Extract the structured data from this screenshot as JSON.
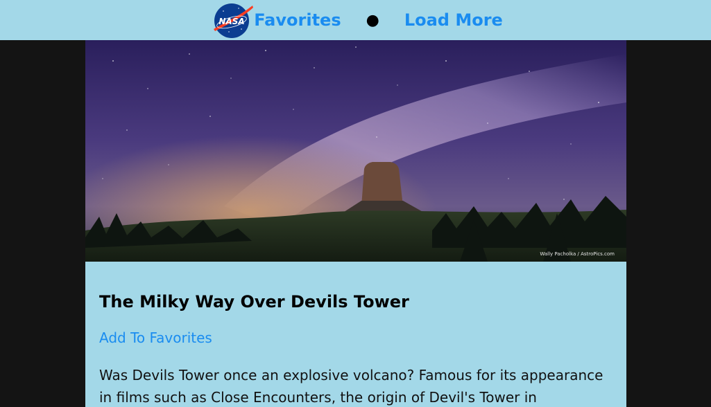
{
  "nav": {
    "logo_icon": "nasa-meatball-logo",
    "favorites_label": "Favorites",
    "separator": "●",
    "load_more_label": "Load More"
  },
  "card": {
    "image_credit": "Wally Pacholka / AstroPics.com",
    "title": "The Milky Way Over Devils Tower",
    "add_favorites_label": "Add To Favorites",
    "description": "Was Devils Tower once an explosive volcano? Famous for its appearance in films such as Close Encounters, the origin of Devil's Tower in"
  },
  "colors": {
    "nav_bg": "#a3d8e8",
    "link": "#1a8cf0",
    "page_bg": "#141414"
  }
}
